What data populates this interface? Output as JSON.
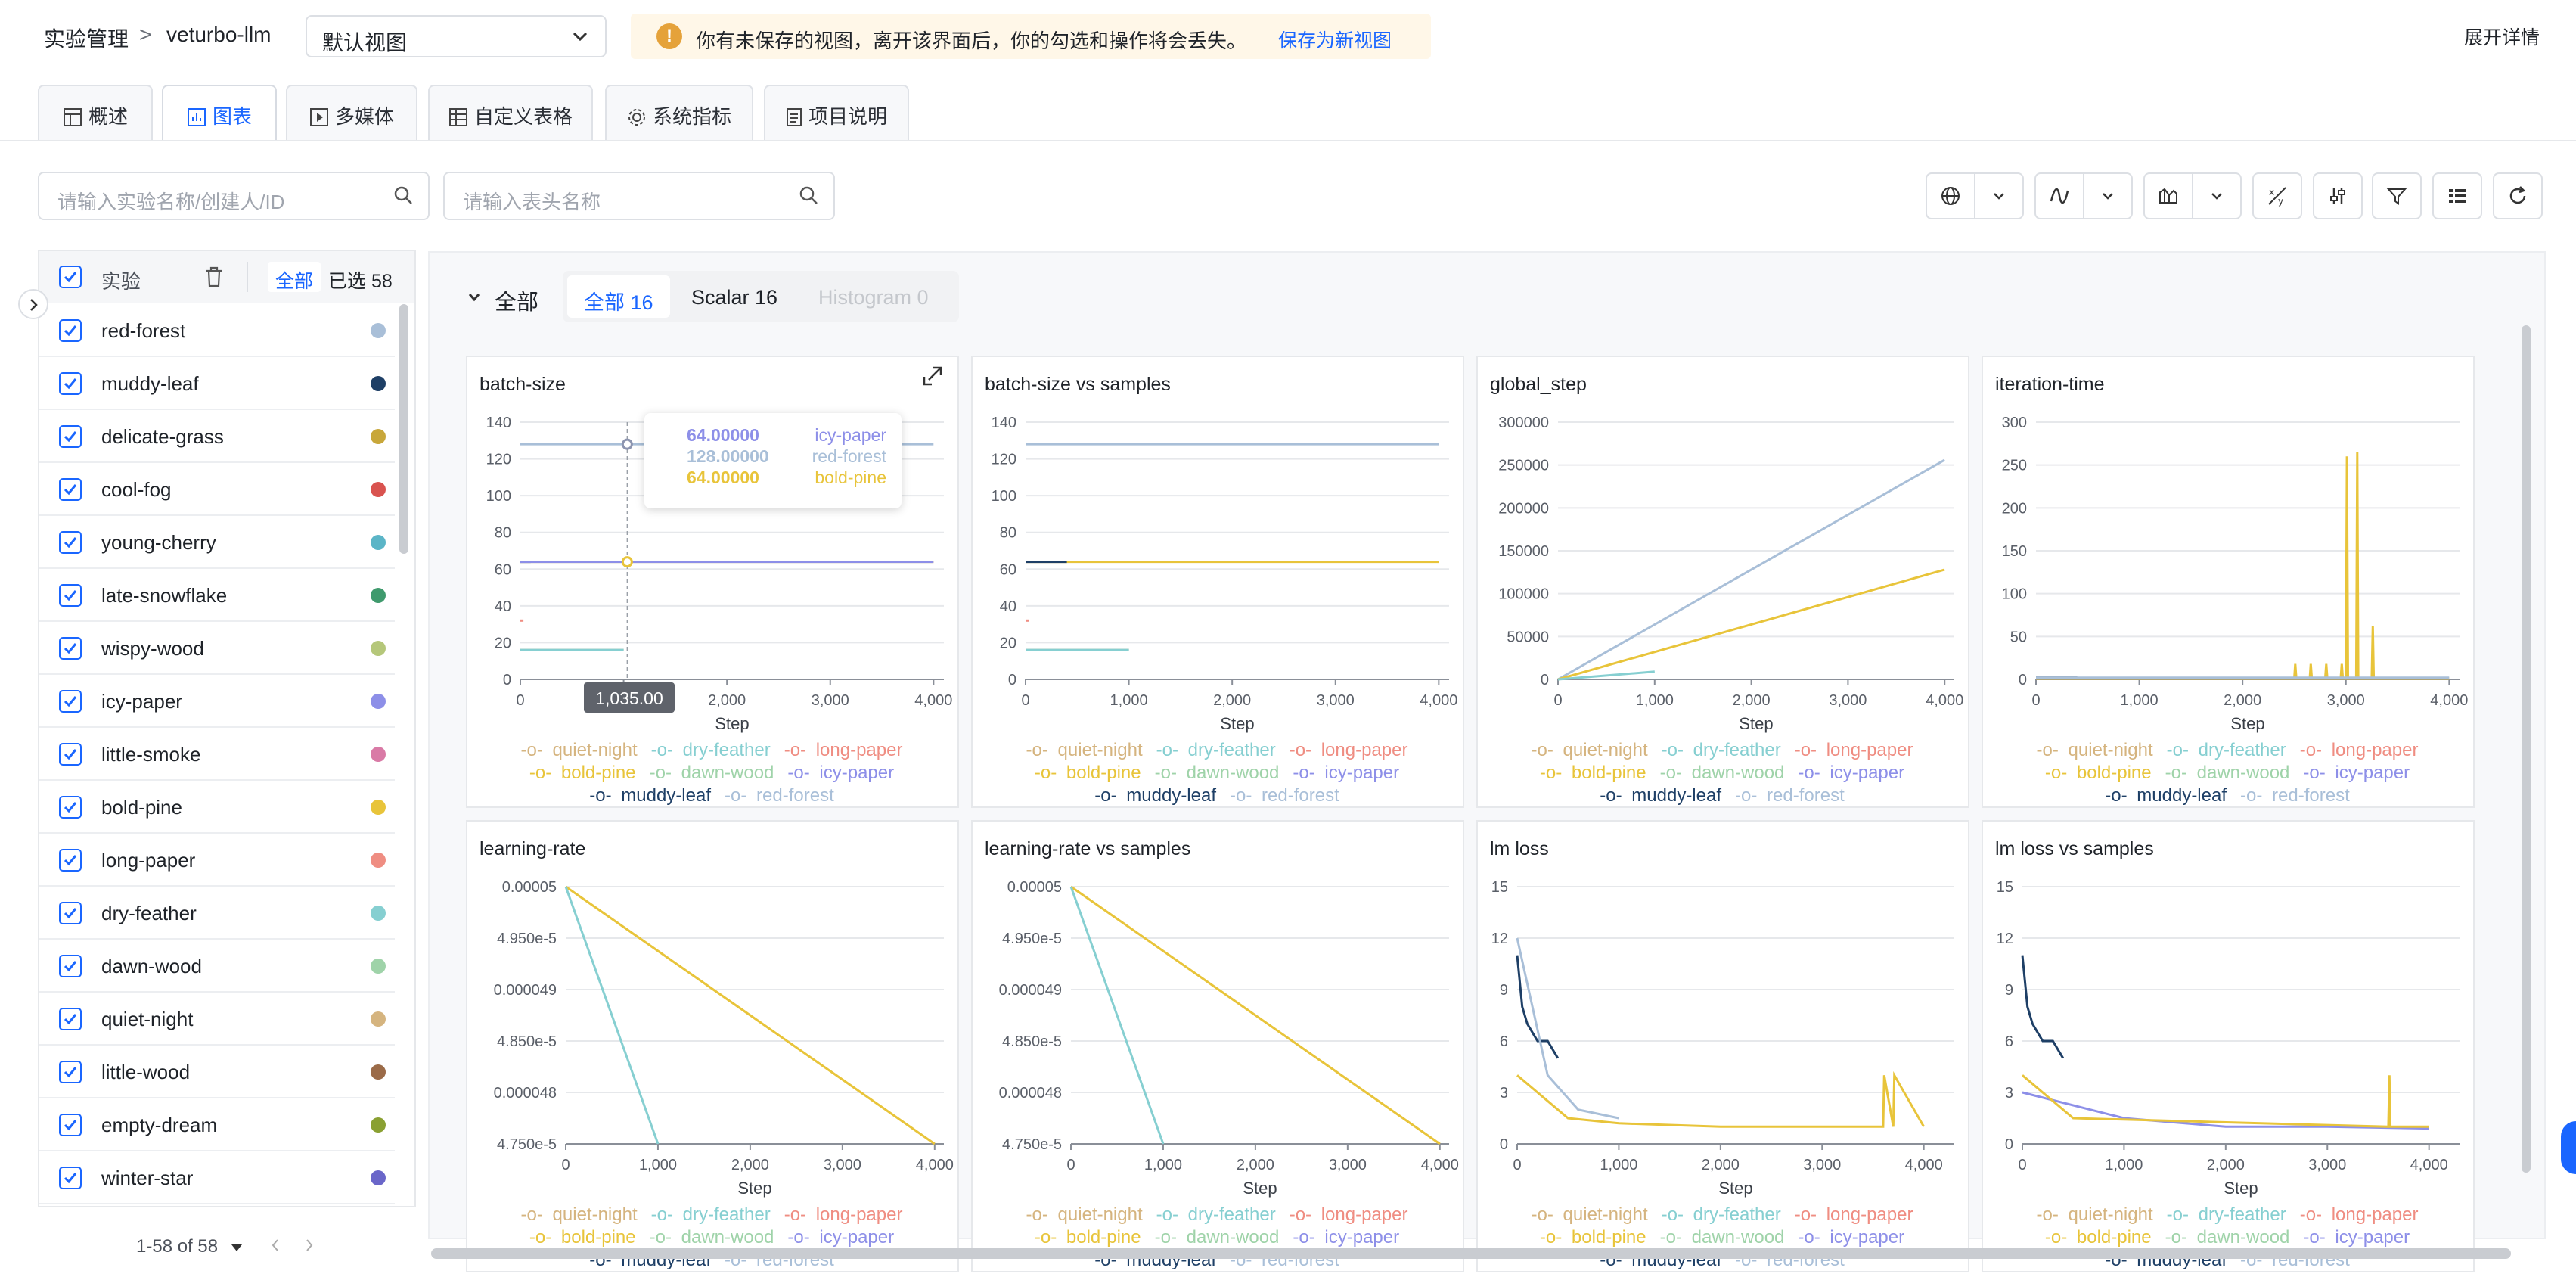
{
  "breadcrumb": {
    "root": "实验管理",
    "sep": ">",
    "project": "veturbo-llm"
  },
  "view_select": {
    "value": "默认视图"
  },
  "warning": {
    "icon": "warning-icon",
    "text": "你有未保存的视图，离开该界面后，你的勾选和操作将会丢失。",
    "action": "保存为新视图"
  },
  "expand_details": "展开详情",
  "tabs": [
    {
      "label": "概述",
      "icon": "table-icon"
    },
    {
      "label": "图表",
      "icon": "chart-icon",
      "active": true
    },
    {
      "label": "多媒体",
      "icon": "play-icon"
    },
    {
      "label": "自定义表格",
      "icon": "table-icon"
    },
    {
      "label": "系统指标",
      "icon": "gear-icon"
    },
    {
      "label": "项目说明",
      "icon": "doc-icon"
    }
  ],
  "search": {
    "experiments_placeholder": "请输入实验名称/创建人/ID",
    "headers_placeholder": "请输入表头名称"
  },
  "sidebar": {
    "header": {
      "title": "实验",
      "all": "全部",
      "selected": "已选 58"
    },
    "items": [
      {
        "label": "red-forest",
        "color": "#a9bfd8"
      },
      {
        "label": "muddy-leaf",
        "color": "#1e3f66"
      },
      {
        "label": "delicate-grass",
        "color": "#c8a73a"
      },
      {
        "label": "cool-fog",
        "color": "#d9534f"
      },
      {
        "label": "young-cherry",
        "color": "#5bb5c7"
      },
      {
        "label": "late-snowflake",
        "color": "#3f9a6d"
      },
      {
        "label": "wispy-wood",
        "color": "#b5c77a"
      },
      {
        "label": "icy-paper",
        "color": "#8d8fe8"
      },
      {
        "label": "little-smoke",
        "color": "#d97aa6"
      },
      {
        "label": "bold-pine",
        "color": "#e8c43a"
      },
      {
        "label": "long-paper",
        "color": "#ef8d82"
      },
      {
        "label": "dry-feather",
        "color": "#86cfd1"
      },
      {
        "label": "dawn-wood",
        "color": "#9fd3a9"
      },
      {
        "label": "quiet-night",
        "color": "#d5b47f"
      },
      {
        "label": "little-wood",
        "color": "#9b6b48"
      },
      {
        "label": "empty-dream",
        "color": "#8aa032"
      },
      {
        "label": "winter-star",
        "color": "#6a66c9"
      }
    ],
    "pagination": "1-58 of 58"
  },
  "section": {
    "title": "全部",
    "filters": [
      {
        "label": "全部 16",
        "active": true
      },
      {
        "label": "Scalar 16"
      },
      {
        "label": "Histogram 0",
        "disabled": true
      }
    ]
  },
  "legend_rows": [
    [
      {
        "name": "quiet-night",
        "color": "#d5b47f"
      },
      {
        "name": "dry-feather",
        "color": "#86cfd1"
      },
      {
        "name": "long-paper",
        "color": "#ef8d82"
      }
    ],
    [
      {
        "name": "bold-pine",
        "color": "#e8c43a"
      },
      {
        "name": "dawn-wood",
        "color": "#9fd3a9"
      },
      {
        "name": "icy-paper",
        "color": "#8d8fe8"
      }
    ],
    [
      {
        "name": "muddy-leaf",
        "color": "#1e3f66"
      },
      {
        "name": "red-forest",
        "color": "#a9bfd8"
      }
    ]
  ],
  "tooltip": {
    "step": "1,035.00",
    "rows": [
      {
        "value": "64.00000",
        "name": "icy-paper",
        "color": "#8d8fe8"
      },
      {
        "value": "128.00000",
        "name": "red-forest",
        "color": "#a9bfd8"
      },
      {
        "value": "64.00000",
        "name": "bold-pine",
        "color": "#e8c43a"
      }
    ]
  },
  "charts": [
    {
      "title": "batch-size",
      "xlabel": "Step",
      "yticks": [
        "140",
        "120",
        "100",
        "80",
        "60",
        "40",
        "20",
        "0"
      ],
      "xticks": [
        "0",
        "1,000",
        "2,000",
        "3,000",
        "4,000"
      ],
      "ylim": [
        0,
        140
      ],
      "xlim": [
        0,
        4100
      ]
    },
    {
      "title": "batch-size vs samples",
      "xlabel": "Step",
      "yticks": [
        "140",
        "120",
        "100",
        "80",
        "60",
        "40",
        "20",
        "0"
      ],
      "xticks": [
        "0",
        "1,000",
        "2,000",
        "3,000",
        "4,000"
      ],
      "ylim": [
        0,
        140
      ],
      "xlim": [
        0,
        4100
      ]
    },
    {
      "title": "global_step",
      "xlabel": "Step",
      "yticks": [
        "300000",
        "250000",
        "200000",
        "150000",
        "100000",
        "50000",
        "0"
      ],
      "xticks": [
        "0",
        "1,000",
        "2,000",
        "3,000",
        "4,000"
      ],
      "ylim": [
        0,
        300000
      ],
      "xlim": [
        0,
        4100
      ]
    },
    {
      "title": "iteration-time",
      "xlabel": "Step",
      "yticks": [
        "300",
        "250",
        "200",
        "150",
        "100",
        "50",
        "0"
      ],
      "xticks": [
        "0",
        "1,000",
        "2,000",
        "3,000",
        "4,000"
      ],
      "ylim": [
        0,
        300
      ],
      "xlim": [
        0,
        4100
      ]
    },
    {
      "title": "learning-rate",
      "xlabel": "Step",
      "yticks": [
        "0.00005",
        "4.950e-5",
        "0.000049",
        "4.850e-5",
        "0.000048",
        "4.750e-5"
      ],
      "xticks": [
        "0",
        "1,000",
        "2,000",
        "3,000",
        "4,000"
      ],
      "ylim": [
        4.75e-05,
        5e-05
      ],
      "xlim": [
        0,
        4100
      ]
    },
    {
      "title": "learning-rate vs samples",
      "xlabel": "Step",
      "yticks": [
        "0.00005",
        "4.950e-5",
        "0.000049",
        "4.850e-5",
        "0.000048",
        "4.750e-5"
      ],
      "xticks": [
        "0",
        "1,000",
        "2,000",
        "3,000",
        "4,000"
      ],
      "ylim": [
        4.75e-05,
        5e-05
      ],
      "xlim": [
        0,
        4100
      ]
    },
    {
      "title": "lm loss",
      "xlabel": "Step",
      "yticks": [
        "15",
        "12",
        "9",
        "6",
        "3",
        "0"
      ],
      "xticks": [
        "0",
        "1,000",
        "2,000",
        "3,000",
        "4,000"
      ],
      "ylim": [
        0,
        15
      ],
      "xlim": [
        0,
        4300
      ]
    },
    {
      "title": "lm loss vs samples",
      "xlabel": "Step",
      "yticks": [
        "15",
        "12",
        "9",
        "6",
        "3",
        "0"
      ],
      "xticks": [
        "0",
        "1,000",
        "2,000",
        "3,000",
        "4,000"
      ],
      "ylim": [
        0,
        15
      ],
      "xlim": [
        0,
        4300
      ]
    }
  ],
  "chart_data": [
    {
      "type": "line",
      "title": "batch-size",
      "xlabel": "Step",
      "ylim": [
        0,
        140
      ],
      "series": [
        {
          "name": "red-forest",
          "x": [
            0,
            4000
          ],
          "y": [
            128,
            128
          ]
        },
        {
          "name": "bold-pine",
          "x": [
            0,
            4000
          ],
          "y": [
            64,
            64
          ]
        },
        {
          "name": "muddy-leaf",
          "x": [
            0,
            100
          ],
          "y": [
            64,
            64
          ]
        },
        {
          "name": "icy-paper",
          "x": [
            0,
            4000
          ],
          "y": [
            64,
            64
          ]
        },
        {
          "name": "quiet-night",
          "x": [
            0,
            1000
          ],
          "y": [
            16,
            16
          ]
        },
        {
          "name": "dry-feather",
          "x": [
            0,
            1000
          ],
          "y": [
            16,
            16
          ]
        },
        {
          "name": "long-paper",
          "x": [
            0,
            30
          ],
          "y": [
            32,
            32
          ]
        }
      ]
    },
    {
      "type": "line",
      "title": "batch-size vs samples",
      "xlabel": "Step",
      "ylim": [
        0,
        140
      ],
      "series": [
        {
          "name": "red-forest",
          "x": [
            0,
            4000
          ],
          "y": [
            128,
            128
          ]
        },
        {
          "name": "bold-pine",
          "x": [
            0,
            4000
          ],
          "y": [
            64,
            64
          ]
        },
        {
          "name": "muddy-leaf",
          "x": [
            0,
            400
          ],
          "y": [
            64,
            64
          ]
        },
        {
          "name": "quiet-night",
          "x": [
            0,
            1000
          ],
          "y": [
            16,
            16
          ]
        },
        {
          "name": "dry-feather",
          "x": [
            0,
            1000
          ],
          "y": [
            16,
            16
          ]
        },
        {
          "name": "long-paper",
          "x": [
            0,
            30
          ],
          "y": [
            32,
            32
          ]
        }
      ]
    },
    {
      "type": "line",
      "title": "global_step",
      "xlabel": "Step",
      "ylim": [
        0,
        300000
      ],
      "series": [
        {
          "name": "red-forest",
          "x": [
            0,
            4000
          ],
          "y": [
            0,
            256000
          ]
        },
        {
          "name": "bold-pine",
          "x": [
            0,
            4000
          ],
          "y": [
            0,
            128000
          ]
        },
        {
          "name": "dry-feather",
          "x": [
            0,
            1000
          ],
          "y": [
            0,
            9000
          ]
        }
      ]
    },
    {
      "type": "line",
      "title": "iteration-time",
      "xlabel": "Step",
      "ylim": [
        0,
        300
      ],
      "series": [
        {
          "name": "muddy-leaf",
          "x": [
            0,
            400
          ],
          "y": [
            2,
            2
          ]
        },
        {
          "name": "bold-pine",
          "x": [
            0,
            2500,
            2510,
            2520,
            2650,
            2660,
            2670,
            2800,
            2810,
            2820,
            2950,
            2960,
            2970,
            3000,
            3010,
            3020,
            3100,
            3110,
            3120,
            3250,
            3260,
            3270,
            4000
          ],
          "y": [
            1,
            1,
            18,
            1,
            1,
            18,
            1,
            1,
            18,
            1,
            1,
            18,
            1,
            1,
            260,
            1,
            1,
            265,
            1,
            1,
            62,
            1,
            1
          ]
        },
        {
          "name": "red-forest",
          "x": [
            0,
            4000
          ],
          "y": [
            2,
            2
          ]
        }
      ]
    },
    {
      "type": "line",
      "title": "learning-rate",
      "xlabel": "Step",
      "ylim": [
        4.75e-05,
        5e-05
      ],
      "series": [
        {
          "name": "bold-pine",
          "x": [
            0,
            4000
          ],
          "y": [
            5e-05,
            4.75e-05
          ]
        },
        {
          "name": "dry-feather",
          "x": [
            0,
            1000
          ],
          "y": [
            5e-05,
            4.75e-05
          ]
        }
      ]
    },
    {
      "type": "line",
      "title": "learning-rate vs samples",
      "xlabel": "Step",
      "ylim": [
        4.75e-05,
        5e-05
      ],
      "series": [
        {
          "name": "bold-pine",
          "x": [
            0,
            4000
          ],
          "y": [
            5e-05,
            4.75e-05
          ]
        },
        {
          "name": "dry-feather",
          "x": [
            0,
            1000
          ],
          "y": [
            5e-05,
            4.75e-05
          ]
        }
      ]
    },
    {
      "type": "line",
      "title": "lm loss",
      "xlabel": "Step",
      "ylim": [
        0,
        15
      ],
      "series": [
        {
          "name": "muddy-leaf",
          "x": [
            0,
            50,
            100,
            200,
            300,
            400
          ],
          "y": [
            11,
            8,
            7,
            6,
            6,
            5
          ]
        },
        {
          "name": "red-forest",
          "x": [
            0,
            300,
            600,
            1000
          ],
          "y": [
            12,
            4,
            2,
            1.5
          ]
        },
        {
          "name": "bold-pine",
          "x": [
            0,
            500,
            1000,
            2000,
            3000,
            3600,
            3610,
            3700,
            3710,
            4000
          ],
          "y": [
            4,
            1.5,
            1.2,
            1,
            1,
            1,
            4,
            1,
            4,
            1
          ]
        }
      ]
    },
    {
      "type": "line",
      "title": "lm loss vs samples",
      "xlabel": "Step",
      "ylim": [
        0,
        15
      ],
      "series": [
        {
          "name": "muddy-leaf",
          "x": [
            0,
            50,
            100,
            200,
            300,
            400
          ],
          "y": [
            11,
            8,
            7,
            6,
            6,
            5
          ]
        },
        {
          "name": "icy-paper",
          "x": [
            0,
            1000,
            2000,
            3000,
            4000
          ],
          "y": [
            3,
            1.5,
            1,
            1,
            0.9
          ]
        },
        {
          "name": "bold-pine",
          "x": [
            0,
            500,
            3600,
            3610,
            3620,
            4000
          ],
          "y": [
            4,
            1.5,
            1,
            4,
            1,
            1
          ]
        }
      ]
    }
  ]
}
